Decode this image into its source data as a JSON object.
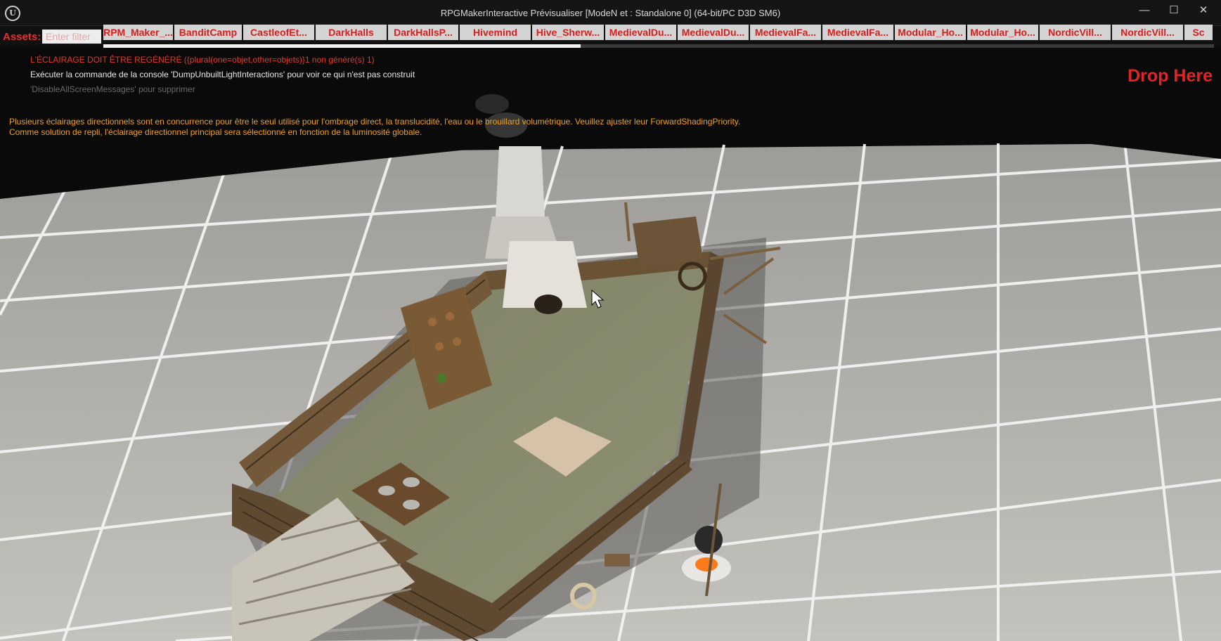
{
  "window": {
    "title": "RPGMakerInteractive Prévisualiser [ModeN et : Standalone 0]  (64-bit/PC D3D SM6)",
    "logo": "unreal-engine-logo",
    "minimize": "—",
    "maximize": "☐",
    "close": "✕"
  },
  "assets": {
    "label": "Assets:",
    "filter_placeholder": "Enter filter",
    "tabs": [
      "RPM_Maker_...",
      "BanditCamp",
      "CastleofEt...",
      "DarkHalls",
      "DarkHallsP...",
      "Hivemind",
      "Hive_Sherw...",
      "MedievalDu...",
      "MedievalDu...",
      "MedievalFa...",
      "MedievalFa...",
      "Modular_Ho...",
      "Modular_Ho...",
      "NordicVill...",
      "NordicVill...",
      "Sc"
    ],
    "load_progress": 0.43
  },
  "messages": {
    "lighting_rebuild": "L'ÉCLAIRAGE DOIT ÊTRE REGÉNÉRÉ ({plural(one=objet,other=objets)}1 non généré(s) 1)",
    "console_hint": "Exécuter la commande de la console 'DumpUnbuiltLightInteractions' pour voir ce qui n'est pas construit",
    "dismiss_hint": "'DisableAllScreenMessages' pour supprimer",
    "directional_warning_line1": "Plusieurs éclairages directionnels sont en concurrence pour être le seul utilisé pour l'ombrage direct, la translucidité, l'eau ou le brouillard volumétrique. Veuillez ajuster leur ForwardShadingPriority.",
    "directional_warning_line2": "Comme solution de repli, l'éclairage directionnel principal sera sélectionné en fonction de la luminosité globale."
  },
  "drop_zone": {
    "label": "Drop Here"
  },
  "colors": {
    "accent_red": "#e32424",
    "warning_orange": "#f0a020",
    "grid_floor": "#b7b5b1",
    "grid_line": "#f2f2f2",
    "wood": "#6b5438"
  },
  "icons": {
    "cursor": "mouse-cursor-icon"
  }
}
